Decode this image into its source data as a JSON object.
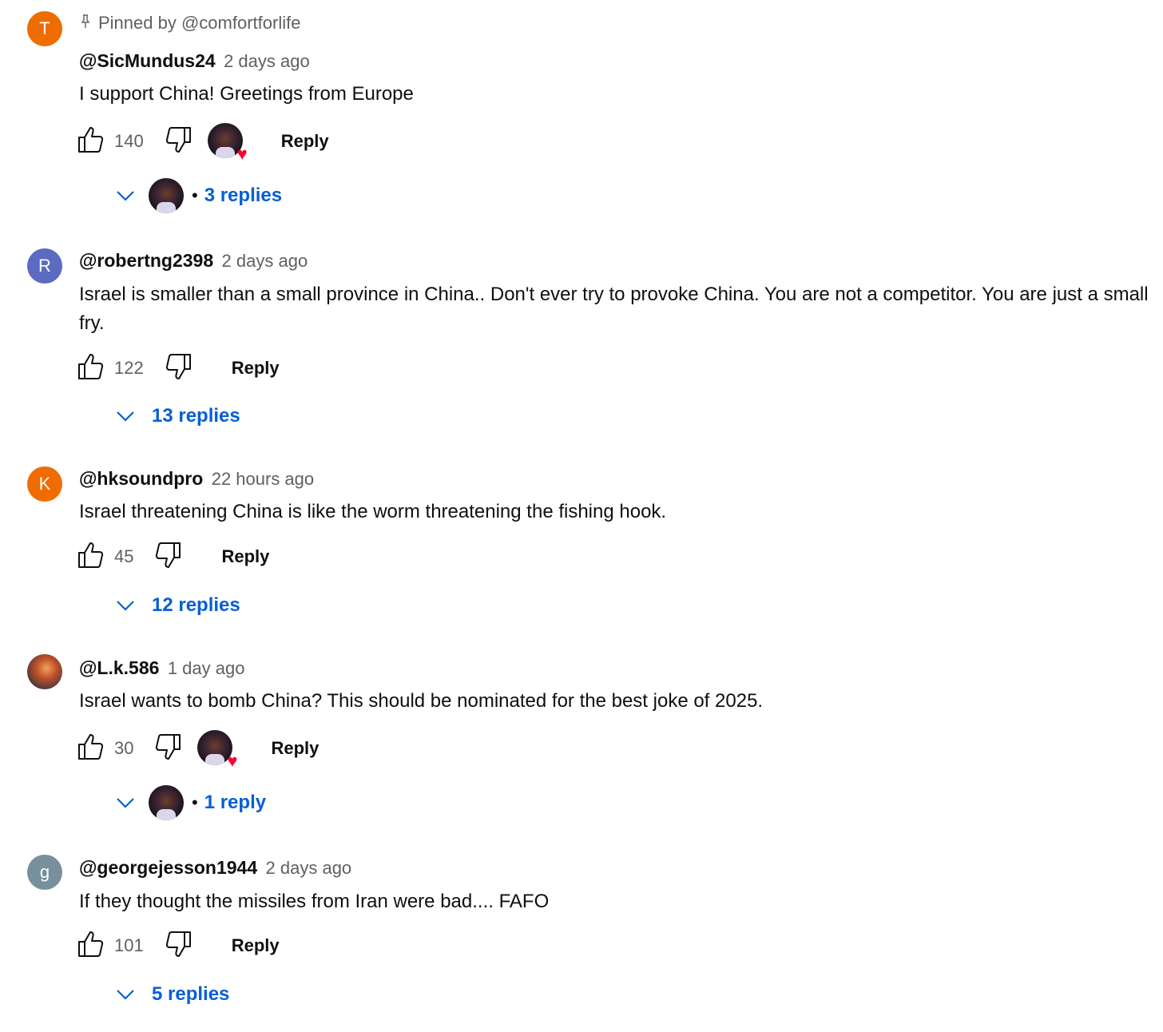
{
  "comments": [
    {
      "avatar_letter": "T",
      "avatar_color": "#ef6c00",
      "pinned_label": "Pinned by @comfortforlife",
      "author": "@SicMundus24",
      "time": "2 days ago",
      "text": "I support China! Greetings from Europe",
      "likes": "140",
      "reply_label": "Reply",
      "creator_heart": true,
      "replies_label": "3 replies"
    },
    {
      "avatar_letter": "R",
      "avatar_color": "#5c6bc0",
      "author": "@robertng2398",
      "time": "2 days ago",
      "text": "Israel is smaller than a small province in China.. Don't ever try to provoke China. You are not a competitor. You are just a small fry.",
      "likes": "122",
      "reply_label": "Reply",
      "creator_heart": false,
      "replies_label": "13 replies"
    },
    {
      "avatar_letter": "K",
      "avatar_color": "#ef6c00",
      "author": "@hksoundpro",
      "time": "22 hours ago",
      "text": "Israel threatening China is like the worm threatening the fishing hook.",
      "likes": "45",
      "reply_label": "Reply",
      "creator_heart": false,
      "replies_label": "12 replies"
    },
    {
      "avatar_letter": "",
      "avatar_color": "#c0522a",
      "author": "@L.k.586",
      "time": "1 day ago",
      "text": "Israel wants to bomb China? This should be nominated for the best joke of 2025.",
      "likes": "30",
      "reply_label": "Reply",
      "creator_heart": true,
      "replies_label": "1 reply"
    },
    {
      "avatar_letter": "g",
      "avatar_color": "#78909c",
      "author": "@georgejesson1944",
      "time": "2 days ago",
      "text": "If they thought the missiles from Iran were bad.... FAFO",
      "likes": "101",
      "reply_label": "Reply",
      "creator_heart": false,
      "replies_label": "5 replies"
    }
  ],
  "icons": {
    "like": "thumb-up-icon",
    "dislike": "thumb-down-icon",
    "expand": "chevron-down-icon",
    "pin": "pin-icon",
    "heart": "heart-icon"
  }
}
